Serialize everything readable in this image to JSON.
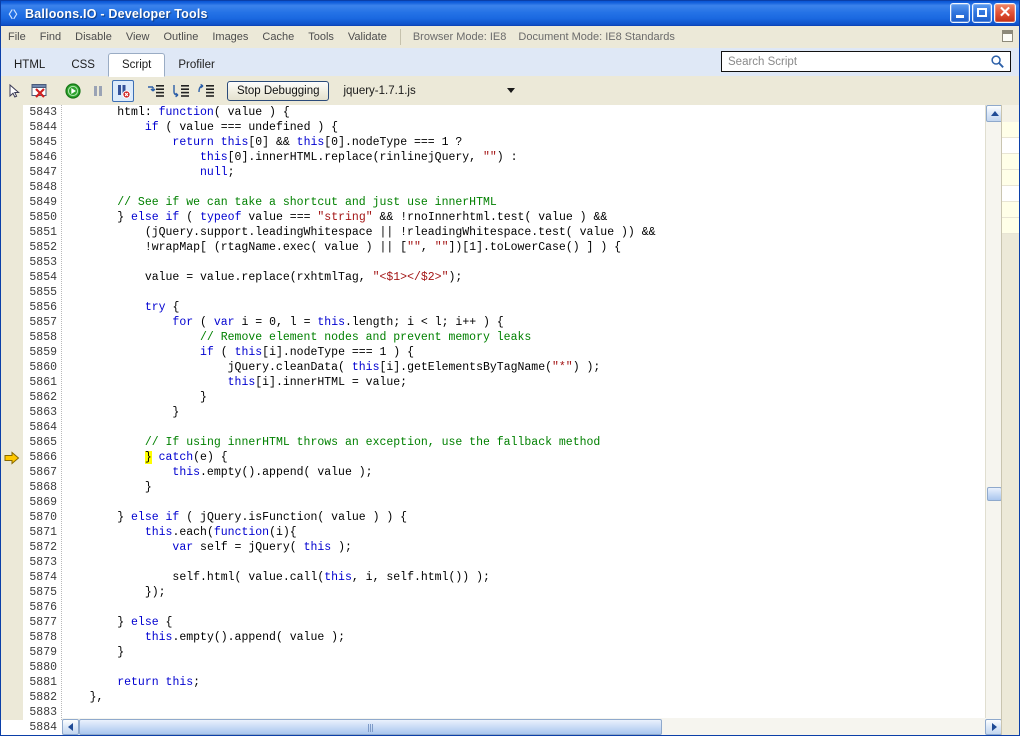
{
  "window": {
    "title": "Balloons.IO - Developer Tools",
    "icon": "devtools-icon",
    "controls": {
      "minimize": "minimize-button",
      "maximize": "maximize-button",
      "close": "close-button",
      "close_glyph": "✕"
    }
  },
  "menubar": {
    "items": [
      "File",
      "Find",
      "Disable",
      "View",
      "Outline",
      "Images",
      "Cache",
      "Tools",
      "Validate"
    ],
    "browser_mode": "Browser Mode: IE8",
    "document_mode": "Document Mode: IE8 Standards"
  },
  "tabs": [
    {
      "label": "HTML",
      "active": false
    },
    {
      "label": "CSS",
      "active": false
    },
    {
      "label": "Script",
      "active": true
    },
    {
      "label": "Profiler",
      "active": false
    }
  ],
  "search": {
    "placeholder": "Search Script",
    "value": ""
  },
  "debug_toolbar": {
    "buttons": [
      {
        "name": "select-element-icon",
        "title": "Select Element"
      },
      {
        "name": "clear-breakpoints-icon",
        "title": "Clear Breakpoints"
      },
      {
        "name": "continue-icon",
        "title": "Continue"
      },
      {
        "name": "break-all-icon",
        "title": "Break All"
      },
      {
        "name": "break-on-error-icon",
        "title": "Break on Error"
      },
      {
        "name": "step-into-icon",
        "title": "Step Into"
      },
      {
        "name": "step-over-icon",
        "title": "Step Over"
      },
      {
        "name": "step-out-icon",
        "title": "Step Out"
      }
    ],
    "stop_label": "Stop Debugging",
    "script_file": "jquery-1.7.1.js"
  },
  "editor": {
    "first_line": 5843,
    "execution_line": 5866,
    "execution_marker": "current-statement-arrow",
    "lines": [
      {
        "n": 5843,
        "t": [
          {
            "x": "        html: "
          },
          {
            "c": "k",
            "x": "function"
          },
          {
            "x": "( value ) {"
          }
        ]
      },
      {
        "n": 5844,
        "t": [
          {
            "x": "            "
          },
          {
            "c": "k",
            "x": "if"
          },
          {
            "x": " ( value === undefined ) {"
          }
        ]
      },
      {
        "n": 5845,
        "t": [
          {
            "x": "                "
          },
          {
            "c": "k",
            "x": "return"
          },
          {
            "x": " "
          },
          {
            "c": "k",
            "x": "this"
          },
          {
            "x": "[0] && "
          },
          {
            "c": "k",
            "x": "this"
          },
          {
            "x": "[0].nodeType === 1 ?"
          }
        ]
      },
      {
        "n": 5846,
        "t": [
          {
            "x": "                    "
          },
          {
            "c": "k",
            "x": "this"
          },
          {
            "x": "[0].innerHTML.replace(rinlinejQuery, "
          },
          {
            "c": "s",
            "x": "\"\""
          },
          {
            "x": ") :"
          }
        ]
      },
      {
        "n": 5847,
        "t": [
          {
            "x": "                    "
          },
          {
            "c": "k",
            "x": "null"
          },
          {
            "x": ";"
          }
        ]
      },
      {
        "n": 5848,
        "t": [
          {
            "x": ""
          }
        ]
      },
      {
        "n": 5849,
        "t": [
          {
            "x": "        "
          },
          {
            "c": "c",
            "x": "// See if we can take a shortcut and just use innerHTML"
          }
        ]
      },
      {
        "n": 5850,
        "t": [
          {
            "x": "        } "
          },
          {
            "c": "k",
            "x": "else"
          },
          {
            "x": " "
          },
          {
            "c": "k",
            "x": "if"
          },
          {
            "x": " ( "
          },
          {
            "c": "k",
            "x": "typeof"
          },
          {
            "x": " value === "
          },
          {
            "c": "s",
            "x": "\"string\""
          },
          {
            "x": " && !rnoInnerhtml.test( value ) &&"
          }
        ]
      },
      {
        "n": 5851,
        "t": [
          {
            "x": "            (jQuery.support.leadingWhitespace || !rleadingWhitespace.test( value )) &&"
          }
        ]
      },
      {
        "n": 5852,
        "t": [
          {
            "x": "            !wrapMap[ (rtagName.exec( value ) || ["
          },
          {
            "c": "s",
            "x": "\"\""
          },
          {
            "x": ", "
          },
          {
            "c": "s",
            "x": "\"\""
          },
          {
            "x": "])[1].toLowerCase() ] ) {"
          }
        ]
      },
      {
        "n": 5853,
        "t": [
          {
            "x": ""
          }
        ]
      },
      {
        "n": 5854,
        "t": [
          {
            "x": "            value = value.replace(rxhtmlTag, "
          },
          {
            "c": "s",
            "x": "\"<$1></$2>\""
          },
          {
            "x": ");"
          }
        ]
      },
      {
        "n": 5855,
        "t": [
          {
            "x": ""
          }
        ]
      },
      {
        "n": 5856,
        "t": [
          {
            "x": "            "
          },
          {
            "c": "k",
            "x": "try"
          },
          {
            "x": " {"
          }
        ]
      },
      {
        "n": 5857,
        "t": [
          {
            "x": "                "
          },
          {
            "c": "k",
            "x": "for"
          },
          {
            "x": " ( "
          },
          {
            "c": "k",
            "x": "var"
          },
          {
            "x": " i = 0, l = "
          },
          {
            "c": "k",
            "x": "this"
          },
          {
            "x": ".length; i < l; i++ ) {"
          }
        ]
      },
      {
        "n": 5858,
        "t": [
          {
            "x": "                    "
          },
          {
            "c": "c",
            "x": "// Remove element nodes and prevent memory leaks"
          }
        ]
      },
      {
        "n": 5859,
        "t": [
          {
            "x": "                    "
          },
          {
            "c": "k",
            "x": "if"
          },
          {
            "x": " ( "
          },
          {
            "c": "k",
            "x": "this"
          },
          {
            "x": "[i].nodeType === 1 ) {"
          }
        ]
      },
      {
        "n": 5860,
        "t": [
          {
            "x": "                        jQuery.cleanData( "
          },
          {
            "c": "k",
            "x": "this"
          },
          {
            "x": "[i].getElementsByTagName("
          },
          {
            "c": "s",
            "x": "\"*\""
          },
          {
            "x": ") );"
          }
        ]
      },
      {
        "n": 5861,
        "t": [
          {
            "x": "                        "
          },
          {
            "c": "k",
            "x": "this"
          },
          {
            "x": "[i].innerHTML = value;"
          }
        ]
      },
      {
        "n": 5862,
        "t": [
          {
            "x": "                    }"
          }
        ]
      },
      {
        "n": 5863,
        "t": [
          {
            "x": "                }"
          }
        ]
      },
      {
        "n": 5864,
        "t": [
          {
            "x": ""
          }
        ]
      },
      {
        "n": 5865,
        "t": [
          {
            "x": "            "
          },
          {
            "c": "c",
            "x": "// If using innerHTML throws an exception, use the fallback method"
          }
        ]
      },
      {
        "n": 5866,
        "t": [
          {
            "x": "            "
          },
          {
            "c": "hl",
            "x": "}"
          },
          {
            "x": " "
          },
          {
            "c": "k",
            "x": "catch"
          },
          {
            "x": "(e) {"
          }
        ]
      },
      {
        "n": 5867,
        "t": [
          {
            "x": "                "
          },
          {
            "c": "k",
            "x": "this"
          },
          {
            "x": ".empty().append( value );"
          }
        ]
      },
      {
        "n": 5868,
        "t": [
          {
            "x": "            }"
          }
        ]
      },
      {
        "n": 5869,
        "t": [
          {
            "x": ""
          }
        ]
      },
      {
        "n": 5870,
        "t": [
          {
            "x": "        } "
          },
          {
            "c": "k",
            "x": "else"
          },
          {
            "x": " "
          },
          {
            "c": "k",
            "x": "if"
          },
          {
            "x": " ( jQuery.isFunction( value ) ) {"
          }
        ]
      },
      {
        "n": 5871,
        "t": [
          {
            "x": "            "
          },
          {
            "c": "k",
            "x": "this"
          },
          {
            "x": ".each("
          },
          {
            "c": "k",
            "x": "function"
          },
          {
            "x": "(i){"
          }
        ]
      },
      {
        "n": 5872,
        "t": [
          {
            "x": "                "
          },
          {
            "c": "k",
            "x": "var"
          },
          {
            "x": " self = jQuery( "
          },
          {
            "c": "k",
            "x": "this"
          },
          {
            "x": " );"
          }
        ]
      },
      {
        "n": 5873,
        "t": [
          {
            "x": ""
          }
        ]
      },
      {
        "n": 5874,
        "t": [
          {
            "x": "                self.html( value.call("
          },
          {
            "c": "k",
            "x": "this"
          },
          {
            "x": ", i, self.html()) );"
          }
        ]
      },
      {
        "n": 5875,
        "t": [
          {
            "x": "            });"
          }
        ]
      },
      {
        "n": 5876,
        "t": [
          {
            "x": ""
          }
        ]
      },
      {
        "n": 5877,
        "t": [
          {
            "x": "        } "
          },
          {
            "c": "k",
            "x": "else"
          },
          {
            "x": " {"
          }
        ]
      },
      {
        "n": 5878,
        "t": [
          {
            "x": "            "
          },
          {
            "c": "k",
            "x": "this"
          },
          {
            "x": ".empty().append( value );"
          }
        ]
      },
      {
        "n": 5879,
        "t": [
          {
            "x": "        }"
          }
        ]
      },
      {
        "n": 5880,
        "t": [
          {
            "x": ""
          }
        ]
      },
      {
        "n": 5881,
        "t": [
          {
            "x": "        "
          },
          {
            "c": "k",
            "x": "return"
          },
          {
            "x": " "
          },
          {
            "c": "k",
            "x": "this"
          },
          {
            "x": ";"
          }
        ]
      },
      {
        "n": 5882,
        "t": [
          {
            "x": "    },"
          }
        ]
      },
      {
        "n": 5883,
        "t": [
          {
            "x": ""
          }
        ]
      },
      {
        "n": 5884,
        "t": [
          {
            "x": ""
          }
        ]
      }
    ]
  },
  "scrollbars": {
    "vertical": {
      "up": "scroll-up-arrow",
      "down": "scroll-down-arrow"
    },
    "horizontal": {
      "left": "scroll-left-arrow",
      "right": "scroll-right-arrow"
    }
  },
  "colors": {
    "keyword": "#0000d0",
    "string": "#a31515",
    "comment": "#008000",
    "highlight": "#ffff00",
    "titlebar": "#1864de",
    "chrome": "#ece9d8"
  }
}
